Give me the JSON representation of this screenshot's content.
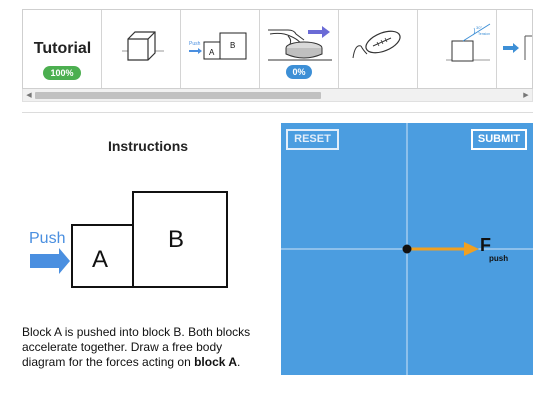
{
  "strip": {
    "tutorial_label": "Tutorial",
    "tutorial_progress": "100%",
    "current_progress": "0%",
    "thumb_small_push": "Push",
    "thumb_block_a": "A",
    "thumb_block_b": "B",
    "thumb_ramp_angle": "30°",
    "thumb_ramp_tension": "Tension",
    "thumbnails": [
      "box-icon",
      "push-blocks-icon",
      "hand-push-icon",
      "football-icon",
      "ramp-box-icon",
      "arrow-icon"
    ]
  },
  "instructions": {
    "title": "Instructions",
    "push_label": "Push",
    "block_a": "A",
    "block_b": "B",
    "text_part1": "Block A is pushed into block B. Both blocks accelerate together. Draw a free body diagram for the forces acting on ",
    "text_bold": "block A",
    "text_end": "."
  },
  "canvas": {
    "reset_label": "RESET",
    "submit_label": "SUBMIT",
    "force_label": "F",
    "force_subscript": "push",
    "background": "#4b9de0",
    "force_color": "#f0a020"
  },
  "colors": {
    "accent_green": "#4caf50",
    "accent_blue": "#3d8fd6",
    "push_blue": "#4a8fe0"
  }
}
